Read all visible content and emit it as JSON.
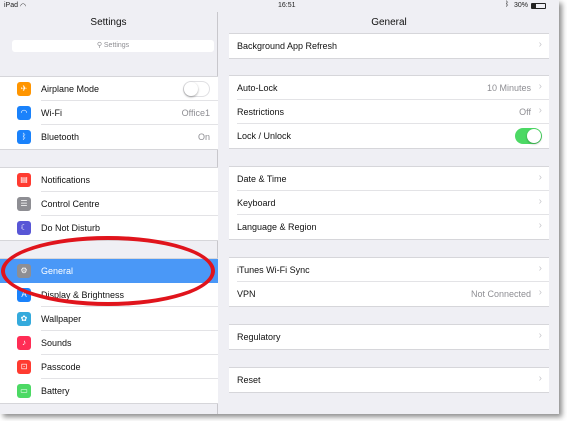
{
  "status": {
    "device": "iPad",
    "time": "16:51",
    "battery": "30%"
  },
  "left": {
    "title": "Settings",
    "search_placeholder": "Settings",
    "group1": [
      {
        "label": "Airplane Mode",
        "icon": "airplane-icon",
        "color": "#ff9500",
        "toggle": "off"
      },
      {
        "label": "Wi-Fi",
        "icon": "wifi-icon",
        "color": "#1a82fb",
        "value": "Office1"
      },
      {
        "label": "Bluetooth",
        "icon": "bluetooth-icon",
        "color": "#1a82fb",
        "value": "On"
      }
    ],
    "group2": [
      {
        "label": "Notifications",
        "icon": "notifications-icon",
        "color": "#ff3b30"
      },
      {
        "label": "Control Centre",
        "icon": "control-centre-icon",
        "color": "#8e8e93"
      },
      {
        "label": "Do Not Disturb",
        "icon": "moon-icon",
        "color": "#5856d6"
      }
    ],
    "group3": [
      {
        "label": "General",
        "icon": "gear-icon",
        "color": "#8e8e93",
        "selected": true
      },
      {
        "label": "Display & Brightness",
        "icon": "display-icon",
        "color": "#1a82fb"
      },
      {
        "label": "Wallpaper",
        "icon": "wallpaper-icon",
        "color": "#34aadc"
      },
      {
        "label": "Sounds",
        "icon": "sounds-icon",
        "color": "#ff2d55"
      },
      {
        "label": "Passcode",
        "icon": "passcode-icon",
        "color": "#ff3b30"
      },
      {
        "label": "Battery",
        "icon": "battery-icon",
        "color": "#4cd964"
      }
    ]
  },
  "right": {
    "title": "General",
    "group0": [
      {
        "label": "Background App Refresh"
      }
    ],
    "group1": [
      {
        "label": "Auto-Lock",
        "value": "10 Minutes"
      },
      {
        "label": "Restrictions",
        "value": "Off"
      },
      {
        "label": "Lock / Unlock",
        "toggle": "on"
      }
    ],
    "group2": [
      {
        "label": "Date & Time"
      },
      {
        "label": "Keyboard"
      },
      {
        "label": "Language & Region"
      }
    ],
    "group3": [
      {
        "label": "iTunes Wi-Fi Sync"
      },
      {
        "label": "VPN",
        "value": "Not Connected"
      }
    ],
    "group4": [
      {
        "label": "Regulatory"
      }
    ],
    "group5": [
      {
        "label": "Reset"
      }
    ]
  },
  "colors": {
    "accent": "#4a98f7",
    "toggle_on": "#4cd964",
    "annotation": "#e0141c"
  }
}
